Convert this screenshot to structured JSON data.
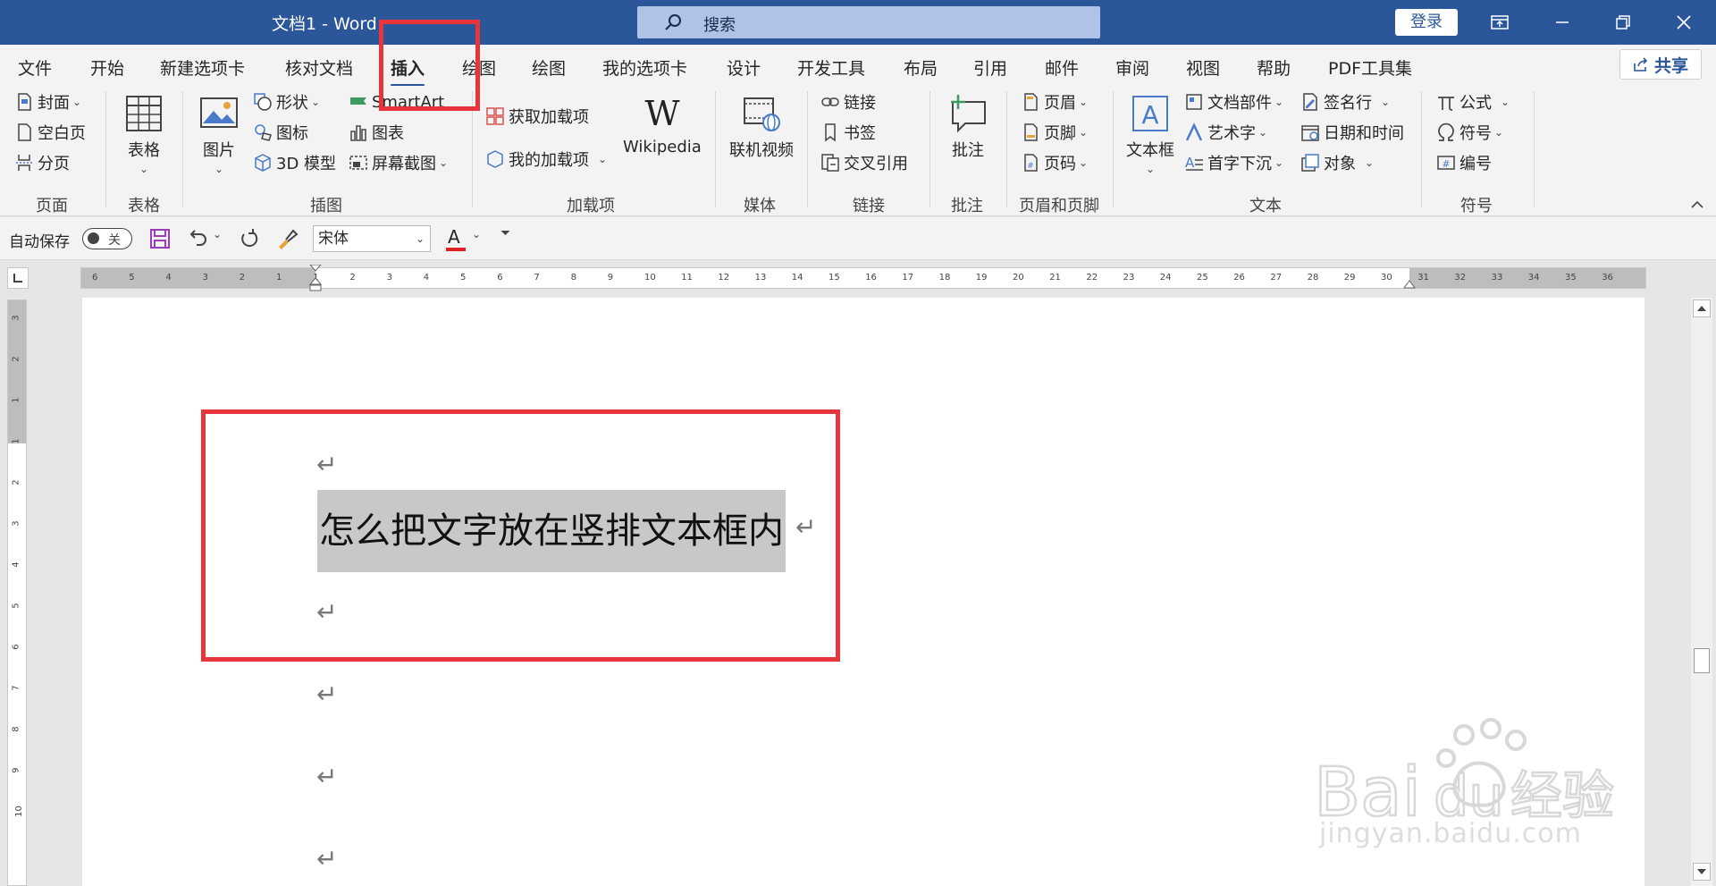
{
  "titlebar": {
    "title": "文档1  -  Word",
    "search_text": "搜索",
    "login": "登录"
  },
  "tabs": [
    "文件",
    "开始",
    "新建选项卡",
    "核对文档",
    "插入",
    "绘图",
    "绘图",
    "我的选项卡",
    "设计",
    "开发工具",
    "布局",
    "引用",
    "邮件",
    "审阅",
    "视图",
    "帮助",
    "PDF工具集"
  ],
  "active_tab": "插入",
  "share": "共享",
  "ribbon": {
    "page": {
      "cover": "封面",
      "blank": "空白页",
      "break": "分页",
      "label": "页面"
    },
    "table": {
      "table": "表格",
      "label": "表格"
    },
    "illustrations": {
      "picture": "图片",
      "shapes": "形状",
      "icons": "图标",
      "model3d": "3D 模型",
      "smartart": "SmartArt",
      "chart": "图表",
      "screenshot": "屏幕截图",
      "label": "插图"
    },
    "addins": {
      "get": "获取加载项",
      "mine": "我的加载项",
      "wikipedia": "Wikipedia",
      "label": "加载项"
    },
    "media": {
      "video": "联机视频",
      "label": "媒体"
    },
    "links": {
      "link": "链接",
      "bookmark": "书签",
      "crossref": "交叉引用",
      "label": "链接"
    },
    "comments": {
      "comment": "批注",
      "label": "批注"
    },
    "headerfooter": {
      "header": "页眉",
      "footer": "页脚",
      "pagenum": "页码",
      "label": "页眉和页脚"
    },
    "text": {
      "textbox": "文本框",
      "parts": "文档部件",
      "wordart": "艺术字",
      "dropcap": "首字下沉",
      "signature": "签名行",
      "datetime": "日期和时间",
      "object": "对象",
      "label": "文本"
    },
    "symbols": {
      "equation": "公式",
      "symbol": "符号",
      "number": "编号",
      "label": "符号"
    }
  },
  "qat": {
    "autosave": "自动保存",
    "toggle": "关",
    "font": "宋体",
    "fontcolor_letter": "A"
  },
  "ruler_h": [
    "6",
    "5",
    "4",
    "3",
    "2",
    "1",
    "1",
    "2",
    "3",
    "4",
    "5",
    "6",
    "7",
    "8",
    "9",
    "10",
    "11",
    "12",
    "13",
    "14",
    "15",
    "16",
    "17",
    "18",
    "19",
    "20",
    "21",
    "22",
    "23",
    "24",
    "25",
    "26",
    "27",
    "28",
    "29",
    "30",
    "31",
    "32",
    "33",
    "34",
    "35",
    "36"
  ],
  "ruler_v": [
    "3",
    "2",
    "1",
    "1",
    "2",
    "3",
    "4",
    "5",
    "6",
    "7",
    "8",
    "9",
    "10"
  ],
  "document": {
    "selected_text": "怎么把文字放在竖排文本框内",
    "paragraph_mark": "↵"
  },
  "watermark": {
    "brand": "Bai经验",
    "url": "jingyan.baidu.com"
  },
  "colors": {
    "brand": "#2b579a",
    "highlight": "#e8353b",
    "selection": "#c8c8c8"
  }
}
